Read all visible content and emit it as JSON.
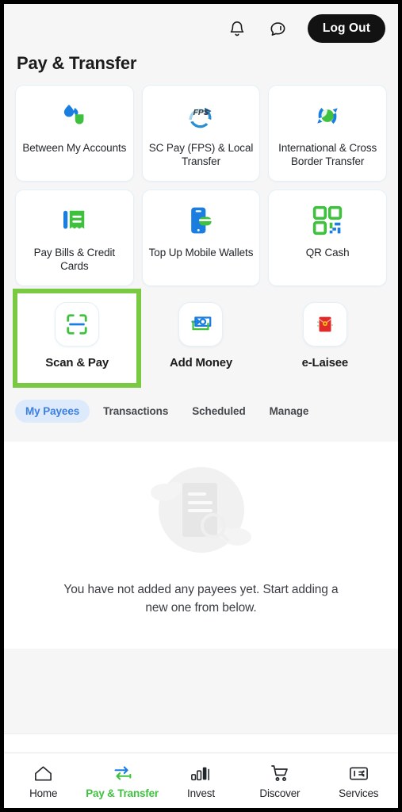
{
  "header": {
    "title": "Pay & Transfer",
    "notification_icon": "bell-icon",
    "chat_icon": "chat-bubble-icon",
    "logout_label": "Log Out"
  },
  "colors": {
    "brand_green": "#3fc13f",
    "brand_blue": "#1a7de0",
    "highlight_green": "#7ac943",
    "tab_active_bg": "#dceafb",
    "tab_active_text": "#3b7fe0",
    "page_bg": "#f6f6f6",
    "red_envelope": "#e02b2b"
  },
  "tiles": [
    {
      "label": "Between My Accounts",
      "icon": "two-drops-transfer-icon"
    },
    {
      "label": "SC Pay (FPS) & Local Transfer",
      "icon": "fps-icon"
    },
    {
      "label": "International & Cross Border Transfer",
      "icon": "globe-arrows-icon"
    },
    {
      "label": "Pay Bills & Credit Cards",
      "icon": "receipt-icon"
    },
    {
      "label": "Top Up Mobile Wallets",
      "icon": "mobile-wallet-icon"
    },
    {
      "label": "QR Cash",
      "icon": "qr-code-icon"
    }
  ],
  "quick_actions": [
    {
      "label": "Scan & Pay",
      "icon": "scan-frame-icon",
      "highlighted": true
    },
    {
      "label": "Add Money",
      "icon": "banknote-arrow-icon",
      "highlighted": false
    },
    {
      "label": "e-Laisee",
      "icon": "red-envelope-icon",
      "highlighted": false
    }
  ],
  "tabs": [
    {
      "label": "My Payees",
      "active": true
    },
    {
      "label": "Transactions",
      "active": false
    },
    {
      "label": "Scheduled",
      "active": false
    },
    {
      "label": "Manage",
      "active": false
    }
  ],
  "empty_state": {
    "illustration": "document-magnifier-icon",
    "message": "You have not added any payees yet. Start adding a new one from below."
  },
  "bottom_nav": [
    {
      "label": "Home",
      "icon": "home-icon",
      "active": false
    },
    {
      "label": "Pay & Transfer",
      "icon": "transfer-arrows-icon",
      "active": true
    },
    {
      "label": "Invest",
      "icon": "bar-chart-icon",
      "active": false
    },
    {
      "label": "Discover",
      "icon": "cart-icon",
      "active": false
    },
    {
      "label": "Services",
      "icon": "services-card-icon",
      "active": false
    }
  ]
}
